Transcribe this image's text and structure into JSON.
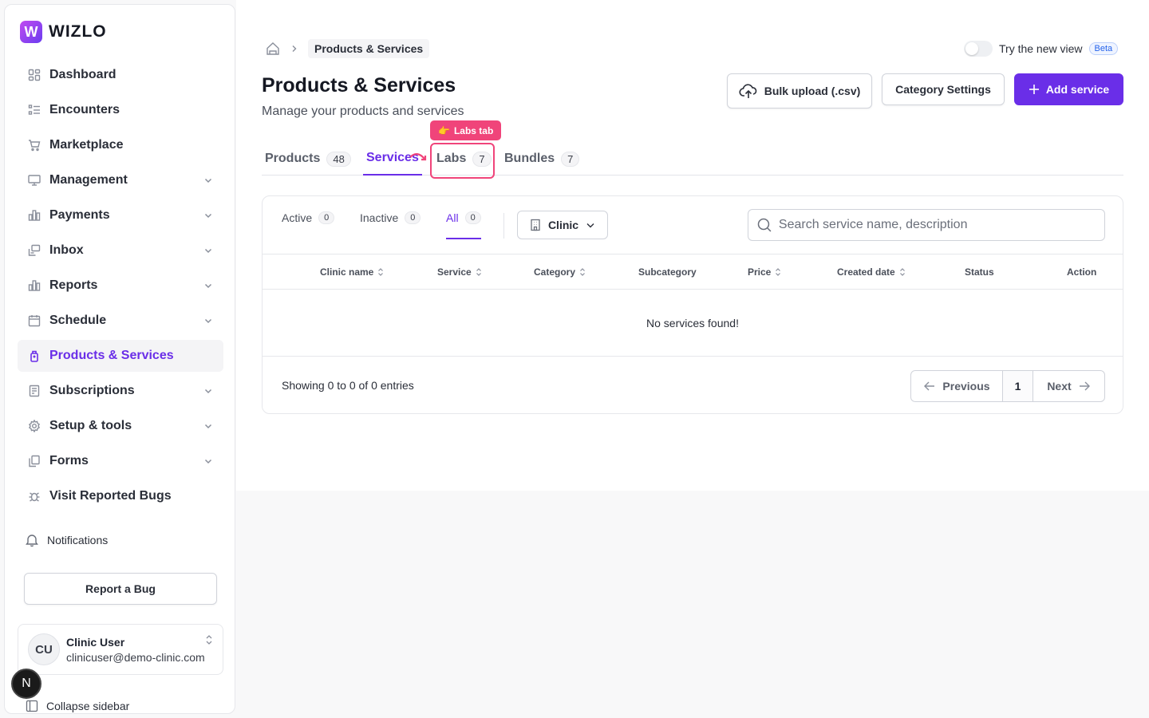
{
  "app": {
    "logo_text": "WIZLO",
    "accent": "#6a2ee8",
    "highlight": "#f0447a"
  },
  "sidebar": {
    "items": [
      {
        "label": "Dashboard",
        "icon": "grid-icon",
        "has_chevron": false
      },
      {
        "label": "Encounters",
        "icon": "list-icon",
        "has_chevron": false
      },
      {
        "label": "Marketplace",
        "icon": "cart-icon",
        "has_chevron": false
      },
      {
        "label": "Management",
        "icon": "monitor-icon",
        "has_chevron": true
      },
      {
        "label": "Payments",
        "icon": "bar-chart-icon",
        "has_chevron": true
      },
      {
        "label": "Inbox",
        "icon": "inbox-icon",
        "has_chevron": true
      },
      {
        "label": "Reports",
        "icon": "bar-chart-icon",
        "has_chevron": true
      },
      {
        "label": "Schedule",
        "icon": "calendar-icon",
        "has_chevron": true
      },
      {
        "label": "Products & Services",
        "icon": "bottle-icon",
        "has_chevron": false,
        "active": true
      },
      {
        "label": "Subscriptions",
        "icon": "receipt-icon",
        "has_chevron": true
      },
      {
        "label": "Setup & tools",
        "icon": "gear-icon",
        "has_chevron": true
      },
      {
        "label": "Forms",
        "icon": "copy-icon",
        "has_chevron": true
      },
      {
        "label": "Visit Reported Bugs",
        "icon": "bug-icon",
        "has_chevron": false
      }
    ],
    "notifications_label": "Notifications",
    "report_bug_label": "Report a Bug",
    "user": {
      "initials": "CU",
      "name": "Clinic User",
      "email": "clinicuser@demo-clinic.com"
    },
    "collapse_label": "Collapse sidebar",
    "next_badge": "N"
  },
  "header": {
    "breadcrumb_current": "Products & Services",
    "new_view_label": "Try the new view",
    "beta_label": "Beta",
    "title": "Products & Services",
    "subtitle": "Manage your products and services",
    "bulk_upload_label": "Bulk upload (.csv)",
    "category_settings_label": "Category Settings",
    "add_service_label": "Add service"
  },
  "tabs": [
    {
      "label": "Products",
      "count": "48"
    },
    {
      "label": "Services",
      "count": "",
      "active": true
    },
    {
      "label": "Labs",
      "count": "7"
    },
    {
      "label": "Bundles",
      "count": "7"
    }
  ],
  "highlight": {
    "label": "Labs tab",
    "emoji": "👉"
  },
  "filters": {
    "subtabs": [
      {
        "label": "Active",
        "count": "0"
      },
      {
        "label": "Inactive",
        "count": "0"
      },
      {
        "label": "All",
        "count": "0",
        "active": true
      }
    ],
    "clinic_label": "Clinic",
    "search_placeholder": "Search service name, description"
  },
  "table": {
    "columns": [
      "Clinic name",
      "Service",
      "Category",
      "Subcategory",
      "Price",
      "Created date",
      "Status",
      "Action"
    ],
    "sortable": [
      true,
      true,
      true,
      false,
      true,
      true,
      false,
      false
    ],
    "empty_text": "No services found!"
  },
  "pagination": {
    "showing_text": "Showing 0 to 0 of 0 entries",
    "previous_label": "Previous",
    "page": "1",
    "next_label": "Next"
  }
}
